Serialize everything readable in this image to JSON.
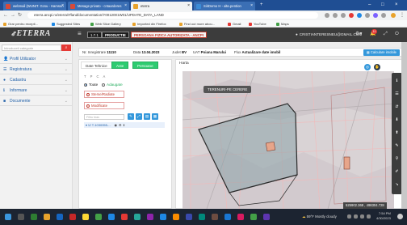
{
  "browser": {
    "tabs": [
      {
        "label": "webmail (WUNIT. Gcsu - Hamson",
        "color": "#d64a3a"
      },
      {
        "label": "Mesage privato - cntaarderes",
        "color": "#d64a3a"
      },
      {
        "label": "eterra",
        "color": "#e8a32c",
        "active": true
      },
      {
        "label": "SiriDemo H - alte.pention",
        "color": "#3b8bd6"
      }
    ],
    "url": "eterra.ancpi.ro/eterra/#/land/documentation/Y0012001W01/UPDATE_DATA_LAND",
    "bookmarks": [
      {
        "label": "Orar pentru recepti...",
        "color": "#e8a32c"
      },
      {
        "label": "Suggested Sites",
        "color": "#1e88e5"
      },
      {
        "label": "Web Slice Gallery",
        "color": "#43a047"
      },
      {
        "label": "Imported din Firefox",
        "color": "#e8a32c"
      },
      {
        "label": "Find out more abou...",
        "color": "#e8a32c"
      },
      {
        "label": "Gmail",
        "color": "#e53935"
      },
      {
        "label": "YouTube",
        "color": "#e53935"
      },
      {
        "label": "Maps",
        "color": "#43a047"
      }
    ]
  },
  "header": {
    "logo": "ETERRA",
    "version": "1.7.1",
    "env": "PRODUCTIE",
    "person_type": "PERSOANA FIZICA AUTORIZATA - ANCPI",
    "user_email": "CRISTIANTERESNEU@GMAIL.COM",
    "notif_count": "11"
  },
  "sidebar": {
    "search_placeholder": "Introduceti categorie",
    "items": [
      {
        "label": "Profil Utilizator",
        "icon": "user-icon",
        "glyph": "👤"
      },
      {
        "label": "Registratura",
        "icon": "list-icon",
        "glyph": "☰"
      },
      {
        "label": "Cadastru",
        "icon": "location-icon",
        "glyph": "●"
      },
      {
        "label": "Informare",
        "icon": "info-icon",
        "glyph": "ℹ"
      },
      {
        "label": "Documente",
        "icon": "folder-icon",
        "glyph": "■"
      }
    ]
  },
  "info": {
    "nr_label": "Nr. Inregistrare",
    "nr_value": "11110",
    "date_label": "Data",
    "date_value": "13.04.2023",
    "judet_label": "Judet",
    "judet_value": "BV",
    "uat_label": "UAT",
    "uat_value": "Poiana Marului",
    "flux_label": "Flux",
    "flux_value": "Actualizare date imobil",
    "calc_button": "Calculare imobile"
  },
  "panel": {
    "tabs": [
      "Date Tehnice",
      "Acte",
      "Persoane"
    ],
    "letters": "T P C A",
    "radio_all": "Toate",
    "radio_added": "Adaugate",
    "deleted": "Sterse/Radiate",
    "modified": "Modificate",
    "filter_placeholder": "Filtru bras",
    "layer_label": "T-1030055-..."
  },
  "map": {
    "title": "Harta",
    "layer_label": "TERENURI-PE CERERE",
    "coordinates": "525902.368 , 498304.728"
  },
  "taskbar": {
    "weather": "59°F  Mostly cloudy",
    "time": "7:54 PM",
    "date": "4/30/2023"
  }
}
